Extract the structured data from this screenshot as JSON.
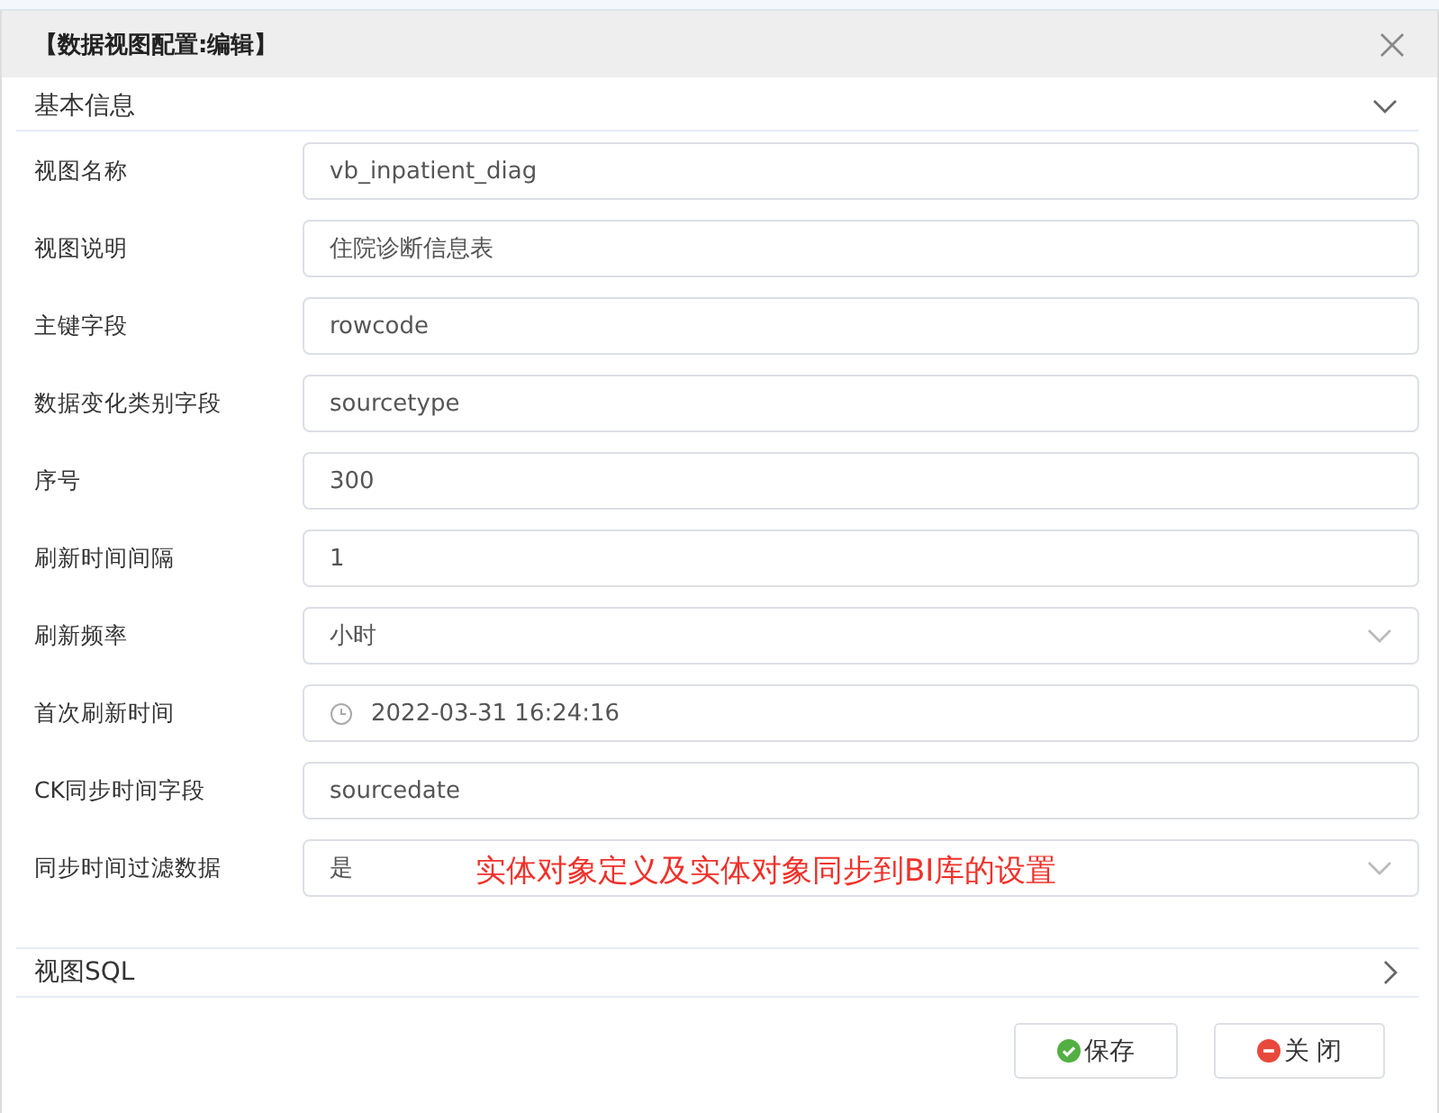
{
  "window": {
    "title": "【数据视图配置:编辑】"
  },
  "sections": [
    {
      "title": "基本信息",
      "expanded": true,
      "fields": [
        {
          "label": "视图名称",
          "kind": "text",
          "value": "vb_inpatient_diag"
        },
        {
          "label": "视图说明",
          "kind": "text",
          "value": "住院诊断信息表"
        },
        {
          "label": "主键字段",
          "kind": "text",
          "value": "rowcode"
        },
        {
          "label": "数据变化类别字段",
          "kind": "text",
          "value": "sourcetype"
        },
        {
          "label": "序号",
          "kind": "text",
          "value": "300"
        },
        {
          "label": "刷新时间间隔",
          "kind": "text",
          "value": "1"
        },
        {
          "label": "刷新频率",
          "kind": "select",
          "value": "小时"
        },
        {
          "label": "首次刷新时间",
          "kind": "date",
          "value": "2022-03-31 16:24:16"
        },
        {
          "label": "CK同步时间字段",
          "kind": "text",
          "value": "sourcedate"
        },
        {
          "label": "同步时间过滤数据",
          "kind": "select",
          "value": "是",
          "annotation": "实体对象定义及实体对象同步到BI库的设置"
        }
      ]
    },
    {
      "title": "视图SQL",
      "expanded": false
    }
  ],
  "buttons": [
    {
      "label": "保存",
      "kind": "save"
    },
    {
      "label": "关 闭",
      "kind": "close"
    }
  ]
}
